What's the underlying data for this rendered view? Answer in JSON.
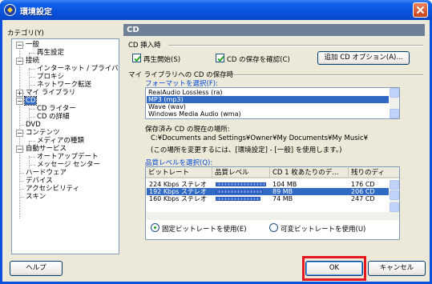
{
  "window": {
    "title": "環境設定"
  },
  "category_label": "カテゴリ(Y)",
  "tree": [
    {
      "label": "一般",
      "level": 0,
      "expander": "−"
    },
    {
      "label": "再生設定",
      "level": 1
    },
    {
      "label": "接続",
      "level": 0,
      "expander": "−"
    },
    {
      "label": "インターネット / プライバシー",
      "level": 1
    },
    {
      "label": "プロキシ",
      "level": 1
    },
    {
      "label": "ネットワーク転送",
      "level": 1
    },
    {
      "label": "マイ ライブラリ",
      "level": 0,
      "expander": "+"
    },
    {
      "label": "CD",
      "level": 0,
      "expander": "−",
      "selected": true
    },
    {
      "label": "CD ライター",
      "level": 1
    },
    {
      "label": "CD の詳細",
      "level": 1
    },
    {
      "label": "DVD",
      "level": 0
    },
    {
      "label": "コンテンツ",
      "level": 0,
      "expander": "−"
    },
    {
      "label": "メディアの種類",
      "level": 1
    },
    {
      "label": "自動サービス",
      "level": 0,
      "expander": "−"
    },
    {
      "label": "オートアップデート",
      "level": 1
    },
    {
      "label": "メッセージ センター",
      "level": 1
    },
    {
      "label": "ハードウェア",
      "level": 0
    },
    {
      "label": "デバイス",
      "level": 0
    },
    {
      "label": "アクセシビリティ",
      "level": 0
    },
    {
      "label": "スキン",
      "level": 0
    }
  ],
  "panel": {
    "title": "CD",
    "insert_section": "CD 挿入時",
    "play_checkbox": {
      "label": "再生開始(S)",
      "checked": true
    },
    "save_checkbox": {
      "label": "CD の保存を確認(C)",
      "checked": true
    },
    "additional_button": "追加 CD オプション(A)...",
    "save_section": "マイ ライブラリへの CD の保存時",
    "format_label": "フォーマットを選択(F):",
    "formats": [
      {
        "label": "RealAudio Lossless (ra)",
        "selected": false
      },
      {
        "label": "MP3 (mp3)",
        "selected": true
      },
      {
        "label": "Wave (wav)",
        "selected": false
      },
      {
        "label": "Windows Media Audio (wma)",
        "selected": false
      }
    ],
    "location_label": "保存済み CD の現在の場所:",
    "location_path": "C:¥Documents and Settings¥Owner¥My Documents¥My Music¥",
    "location_note": "(この場所を変更するには、[環境設定] - [一般] を使用します。)",
    "quality_label": "品質レベルを選択(Q):",
    "quality_columns": [
      "ビットレート",
      "品質レベル",
      "CD 1 枚あたりのデ...",
      "残りのディ"
    ],
    "quality_rows": [
      {
        "bitrate": "224 Kbps ステレオ",
        "quality": 0.95,
        "size": "104 MB",
        "remaining": "176 CD",
        "selected": false
      },
      {
        "bitrate": "192 Kbps ステレオ",
        "quality": 0.9,
        "size": "89 MB",
        "remaining": "206 CD",
        "selected": true
      },
      {
        "bitrate": "160 Kbps ステレオ",
        "quality": 0.85,
        "size": "74 MB",
        "remaining": "247 CD",
        "selected": false
      }
    ],
    "fixed_radio": {
      "label": "固定ビットレートを使用(E)",
      "selected": true
    },
    "variable_radio": {
      "label": "可変ビットレートを使用(U)",
      "selected": false
    }
  },
  "buttons": {
    "help": "ヘルプ",
    "ok": "OK",
    "cancel": "キャンセル"
  },
  "colors": {
    "highlight": "#e8161e",
    "selection": "#316ac5",
    "group_label": "#0046d5"
  }
}
